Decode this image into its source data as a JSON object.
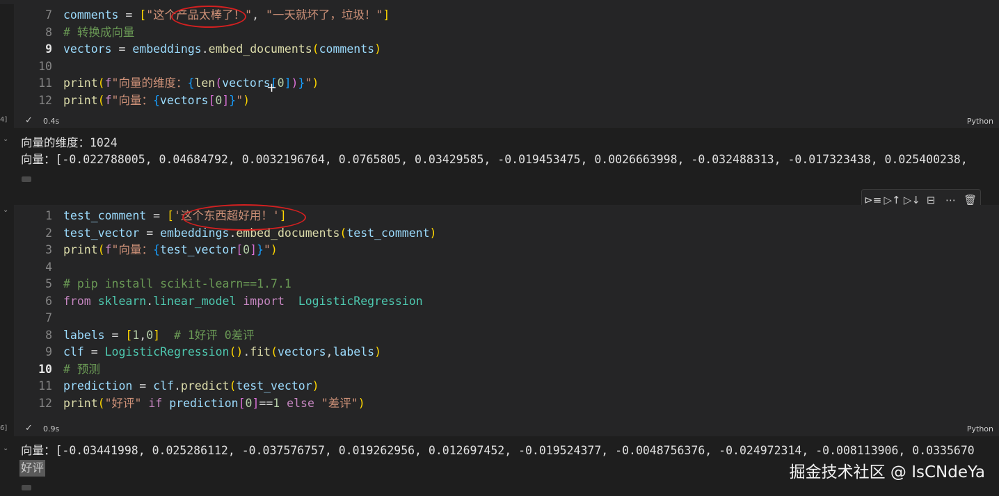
{
  "cell1": {
    "lines": [
      {
        "n": "7",
        "code": [
          {
            "t": "comments",
            "c": "v"
          },
          {
            "t": " = ",
            "c": "p"
          },
          {
            "t": "[",
            "c": "b1"
          },
          {
            "t": "\"这个产品太棒了！\"",
            "c": "s"
          },
          {
            "t": ", ",
            "c": "p"
          },
          {
            "t": "\"一天就坏了，垃圾！\"",
            "c": "s"
          },
          {
            "t": "]",
            "c": "b1"
          }
        ]
      },
      {
        "n": "8",
        "code": [
          {
            "t": "# 转换成向量",
            "c": "c"
          }
        ]
      },
      {
        "n": "9",
        "active": true,
        "code": [
          {
            "t": "vectors",
            "c": "v"
          },
          {
            "t": " = ",
            "c": "p"
          },
          {
            "t": "embeddings",
            "c": "v"
          },
          {
            "t": ".",
            "c": "p"
          },
          {
            "t": "embed_documents",
            "c": "f"
          },
          {
            "t": "(",
            "c": "b1"
          },
          {
            "t": "comments",
            "c": "v"
          },
          {
            "t": ")",
            "c": "b1"
          }
        ]
      },
      {
        "n": "10",
        "code": []
      },
      {
        "n": "11",
        "code": [
          {
            "t": "print",
            "c": "f"
          },
          {
            "t": "(",
            "c": "b1"
          },
          {
            "t": "f",
            "c": "k"
          },
          {
            "t": "\"向量的维度：",
            "c": "s"
          },
          {
            "t": "{",
            "c": "b3"
          },
          {
            "t": "len",
            "c": "f"
          },
          {
            "t": "(",
            "c": "b2"
          },
          {
            "t": "vectors",
            "c": "v"
          },
          {
            "t": "[",
            "c": "b3"
          },
          {
            "t": "0",
            "c": "n"
          },
          {
            "t": "]",
            "c": "b3"
          },
          {
            "t": ")",
            "c": "b2"
          },
          {
            "t": "}",
            "c": "b3"
          },
          {
            "t": "\"",
            "c": "s"
          },
          {
            "t": ")",
            "c": "b1"
          }
        ]
      },
      {
        "n": "12",
        "code": [
          {
            "t": "print",
            "c": "f"
          },
          {
            "t": "(",
            "c": "b1"
          },
          {
            "t": "f",
            "c": "k"
          },
          {
            "t": "\"向量：",
            "c": "s"
          },
          {
            "t": "{",
            "c": "b3"
          },
          {
            "t": "vectors",
            "c": "v"
          },
          {
            "t": "[",
            "c": "b2"
          },
          {
            "t": "0",
            "c": "n"
          },
          {
            "t": "]",
            "c": "b2"
          },
          {
            "t": "}",
            "c": "b3"
          },
          {
            "t": "\"",
            "c": "s"
          },
          {
            "t": ")",
            "c": "b1"
          }
        ]
      }
    ],
    "exec_time": "0.4s",
    "language": "Python",
    "exec_label": "4]",
    "output": [
      "向量的维度：1024",
      "向量：[-0.022788005, 0.04684792, 0.0032196764, 0.0765805, 0.03429585, -0.019453475, 0.0026663998, -0.032488313, -0.017323438, 0.025400238,"
    ]
  },
  "cell2": {
    "lines": [
      {
        "n": "1",
        "code": [
          {
            "t": "test_comment",
            "c": "v"
          },
          {
            "t": " = ",
            "c": "p"
          },
          {
            "t": "[",
            "c": "b1"
          },
          {
            "t": "'这个东西超好用！'",
            "c": "s"
          },
          {
            "t": "]",
            "c": "b1"
          }
        ]
      },
      {
        "n": "2",
        "code": [
          {
            "t": "test_vector",
            "c": "v"
          },
          {
            "t": " = ",
            "c": "p"
          },
          {
            "t": "embeddings",
            "c": "v"
          },
          {
            "t": ".",
            "c": "p"
          },
          {
            "t": "embed_documents",
            "c": "f"
          },
          {
            "t": "(",
            "c": "b1"
          },
          {
            "t": "test_comment",
            "c": "v"
          },
          {
            "t": ")",
            "c": "b1"
          }
        ]
      },
      {
        "n": "3",
        "code": [
          {
            "t": "print",
            "c": "f"
          },
          {
            "t": "(",
            "c": "b1"
          },
          {
            "t": "f",
            "c": "k"
          },
          {
            "t": "\"向量：",
            "c": "s"
          },
          {
            "t": "{",
            "c": "b3"
          },
          {
            "t": "test_vector",
            "c": "v"
          },
          {
            "t": "[",
            "c": "b2"
          },
          {
            "t": "0",
            "c": "n"
          },
          {
            "t": "]",
            "c": "b2"
          },
          {
            "t": "}",
            "c": "b3"
          },
          {
            "t": "\"",
            "c": "s"
          },
          {
            "t": ")",
            "c": "b1"
          }
        ]
      },
      {
        "n": "4",
        "code": []
      },
      {
        "n": "5",
        "code": [
          {
            "t": "# pip install scikit-learn==1.7.1",
            "c": "c"
          }
        ]
      },
      {
        "n": "6",
        "code": [
          {
            "t": "from",
            "c": "k"
          },
          {
            "t": " ",
            "c": "p"
          },
          {
            "t": "sklearn",
            "c": "cls"
          },
          {
            "t": ".",
            "c": "p"
          },
          {
            "t": "linear_model",
            "c": "cls"
          },
          {
            "t": " ",
            "c": "p"
          },
          {
            "t": "import",
            "c": "k"
          },
          {
            "t": "  ",
            "c": "p"
          },
          {
            "t": "LogisticRegression",
            "c": "cls"
          }
        ]
      },
      {
        "n": "7",
        "code": []
      },
      {
        "n": "8",
        "code": [
          {
            "t": "labels",
            "c": "v"
          },
          {
            "t": " = ",
            "c": "p"
          },
          {
            "t": "[",
            "c": "b1"
          },
          {
            "t": "1",
            "c": "n"
          },
          {
            "t": ",",
            "c": "p"
          },
          {
            "t": "0",
            "c": "n"
          },
          {
            "t": "]",
            "c": "b1"
          },
          {
            "t": "  ",
            "c": "p"
          },
          {
            "t": "# 1好评 0差评",
            "c": "c"
          }
        ]
      },
      {
        "n": "9",
        "code": [
          {
            "t": "clf",
            "c": "v"
          },
          {
            "t": " = ",
            "c": "p"
          },
          {
            "t": "LogisticRegression",
            "c": "cls"
          },
          {
            "t": "(",
            "c": "b1"
          },
          {
            "t": ")",
            "c": "b1"
          },
          {
            "t": ".",
            "c": "p"
          },
          {
            "t": "fit",
            "c": "f"
          },
          {
            "t": "(",
            "c": "b1"
          },
          {
            "t": "vectors",
            "c": "v"
          },
          {
            "t": ",",
            "c": "p"
          },
          {
            "t": "labels",
            "c": "v"
          },
          {
            "t": ")",
            "c": "b1"
          }
        ]
      },
      {
        "n": "10",
        "active": true,
        "code": [
          {
            "t": "# 预测",
            "c": "c"
          }
        ]
      },
      {
        "n": "11",
        "code": [
          {
            "t": "prediction",
            "c": "v"
          },
          {
            "t": " = ",
            "c": "p"
          },
          {
            "t": "clf",
            "c": "v"
          },
          {
            "t": ".",
            "c": "p"
          },
          {
            "t": "predict",
            "c": "f"
          },
          {
            "t": "(",
            "c": "b1"
          },
          {
            "t": "test_vector",
            "c": "v"
          },
          {
            "t": ")",
            "c": "b1"
          }
        ]
      },
      {
        "n": "12",
        "code": [
          {
            "t": "print",
            "c": "f"
          },
          {
            "t": "(",
            "c": "b1"
          },
          {
            "t": "\"好评\"",
            "c": "s"
          },
          {
            "t": " ",
            "c": "p"
          },
          {
            "t": "if",
            "c": "k"
          },
          {
            "t": " ",
            "c": "p"
          },
          {
            "t": "prediction",
            "c": "v"
          },
          {
            "t": "[",
            "c": "b2"
          },
          {
            "t": "0",
            "c": "n"
          },
          {
            "t": "]",
            "c": "b2"
          },
          {
            "t": "==",
            "c": "p"
          },
          {
            "t": "1",
            "c": "n"
          },
          {
            "t": " ",
            "c": "p"
          },
          {
            "t": "else",
            "c": "k"
          },
          {
            "t": " ",
            "c": "p"
          },
          {
            "t": "\"差评\"",
            "c": "s"
          },
          {
            "t": ")",
            "c": "b1"
          }
        ]
      }
    ],
    "exec_time": "0.9s",
    "language": "Python",
    "exec_label": "6]",
    "output": [
      "向量：[-0.03441998, 0.025286112, -0.037576757, 0.019262956, 0.012697452, -0.019524377, -0.0048756376, -0.024972314, -0.008113906, 0.0335670",
      "好评"
    ]
  },
  "toolbar": {
    "icons": [
      {
        "name": "run-by-line-icon",
        "glyph": "⊳≡"
      },
      {
        "name": "execute-above-icon",
        "glyph": "▷↑"
      },
      {
        "name": "execute-below-icon",
        "glyph": "▷↓"
      },
      {
        "name": "split-cell-icon",
        "glyph": "⊟"
      },
      {
        "name": "more-actions-icon",
        "glyph": "⋯"
      },
      {
        "name": "delete-cell-icon",
        "glyph": "🗑"
      }
    ]
  },
  "watermark": "掘金技术社区 @ IsCNdeYa",
  "colors": {
    "background": "#1e1e1e",
    "cell_background": "#252526",
    "annotation": "#d42020"
  }
}
